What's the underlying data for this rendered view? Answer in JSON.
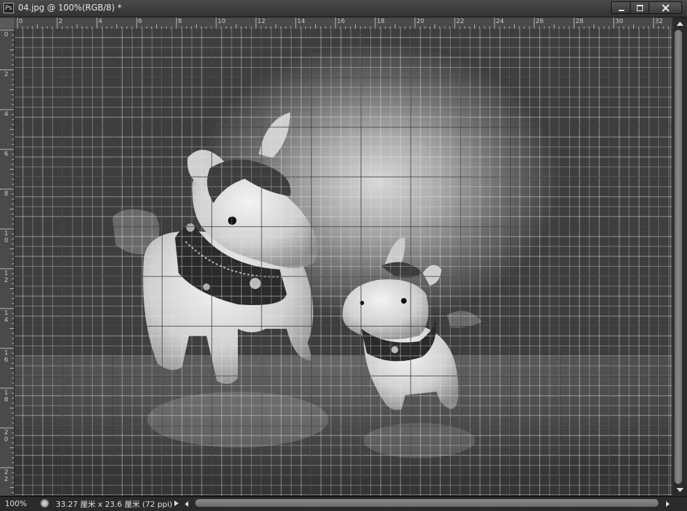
{
  "window": {
    "app_badge": "Ps",
    "title": "04.jpg @ 100%(RGB/8) *",
    "buttons": [
      "minimize-icon",
      "maximize-icon",
      "close-icon"
    ]
  },
  "rulers": {
    "horizontal_labels": [
      "0",
      "2",
      "4",
      "6",
      "8",
      "10",
      "12",
      "14",
      "16",
      "18",
      "20",
      "22",
      "24",
      "26",
      "28",
      "30",
      "32"
    ],
    "vertical_labels": [
      "0",
      "2",
      "4",
      "6",
      "8",
      "10",
      "12",
      "14",
      "16",
      "18",
      "20",
      "22"
    ],
    "unit": "厘米"
  },
  "canvas": {
    "description_icon": "image-canvas",
    "grid_visible": true
  },
  "status": {
    "zoom": "100%",
    "doc_size": "33.27 厘米 x 23.6 厘米 (72 ppi)"
  },
  "colors": {
    "chrome": "#2b2b2b",
    "titlebar": "#3c3c3c",
    "ruler": "#4a4a4a",
    "scroll_thumb": "#7a7a7a"
  }
}
